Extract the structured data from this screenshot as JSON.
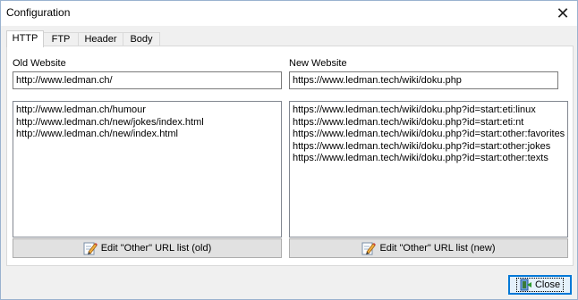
{
  "window": {
    "title": "Configuration",
    "close_glyph": "✕"
  },
  "tabs": [
    {
      "label": "HTTP",
      "active": true
    },
    {
      "label": "FTP",
      "active": false
    },
    {
      "label": "Header",
      "active": false
    },
    {
      "label": "Body",
      "active": false
    }
  ],
  "old_site": {
    "label": "Old Website",
    "value": "http://www.ledman.ch/",
    "urls": [
      "http://www.ledman.ch/humour",
      "http://www.ledman.ch/new/jokes/index.html",
      "http://www.ledman.ch/new/index.html"
    ],
    "edit_button": "Edit \"Other\" URL list (old)"
  },
  "new_site": {
    "label": "New Website",
    "value": "https://www.ledman.tech/wiki/doku.php",
    "urls": [
      "https://www.ledman.tech/wiki/doku.php?id=start:eti:linux",
      "https://www.ledman.tech/wiki/doku.php?id=start:eti:nt",
      "https://www.ledman.tech/wiki/doku.php?id=start:other:favorites",
      "https://www.ledman.tech/wiki/doku.php?id=start:other:jokes",
      "https://www.ledman.tech/wiki/doku.php?id=start:other:texts"
    ],
    "edit_button": "Edit \"Other\" URL list (new)"
  },
  "footer": {
    "close_label": "Close"
  },
  "icons": {
    "pencil": "pencil-icon",
    "close_door": "door-exit-icon",
    "close_window": "close-icon"
  },
  "colors": {
    "accent": "#0078d7",
    "button_face": "#e1e1e1",
    "window_bg": "#f0f0f0"
  }
}
